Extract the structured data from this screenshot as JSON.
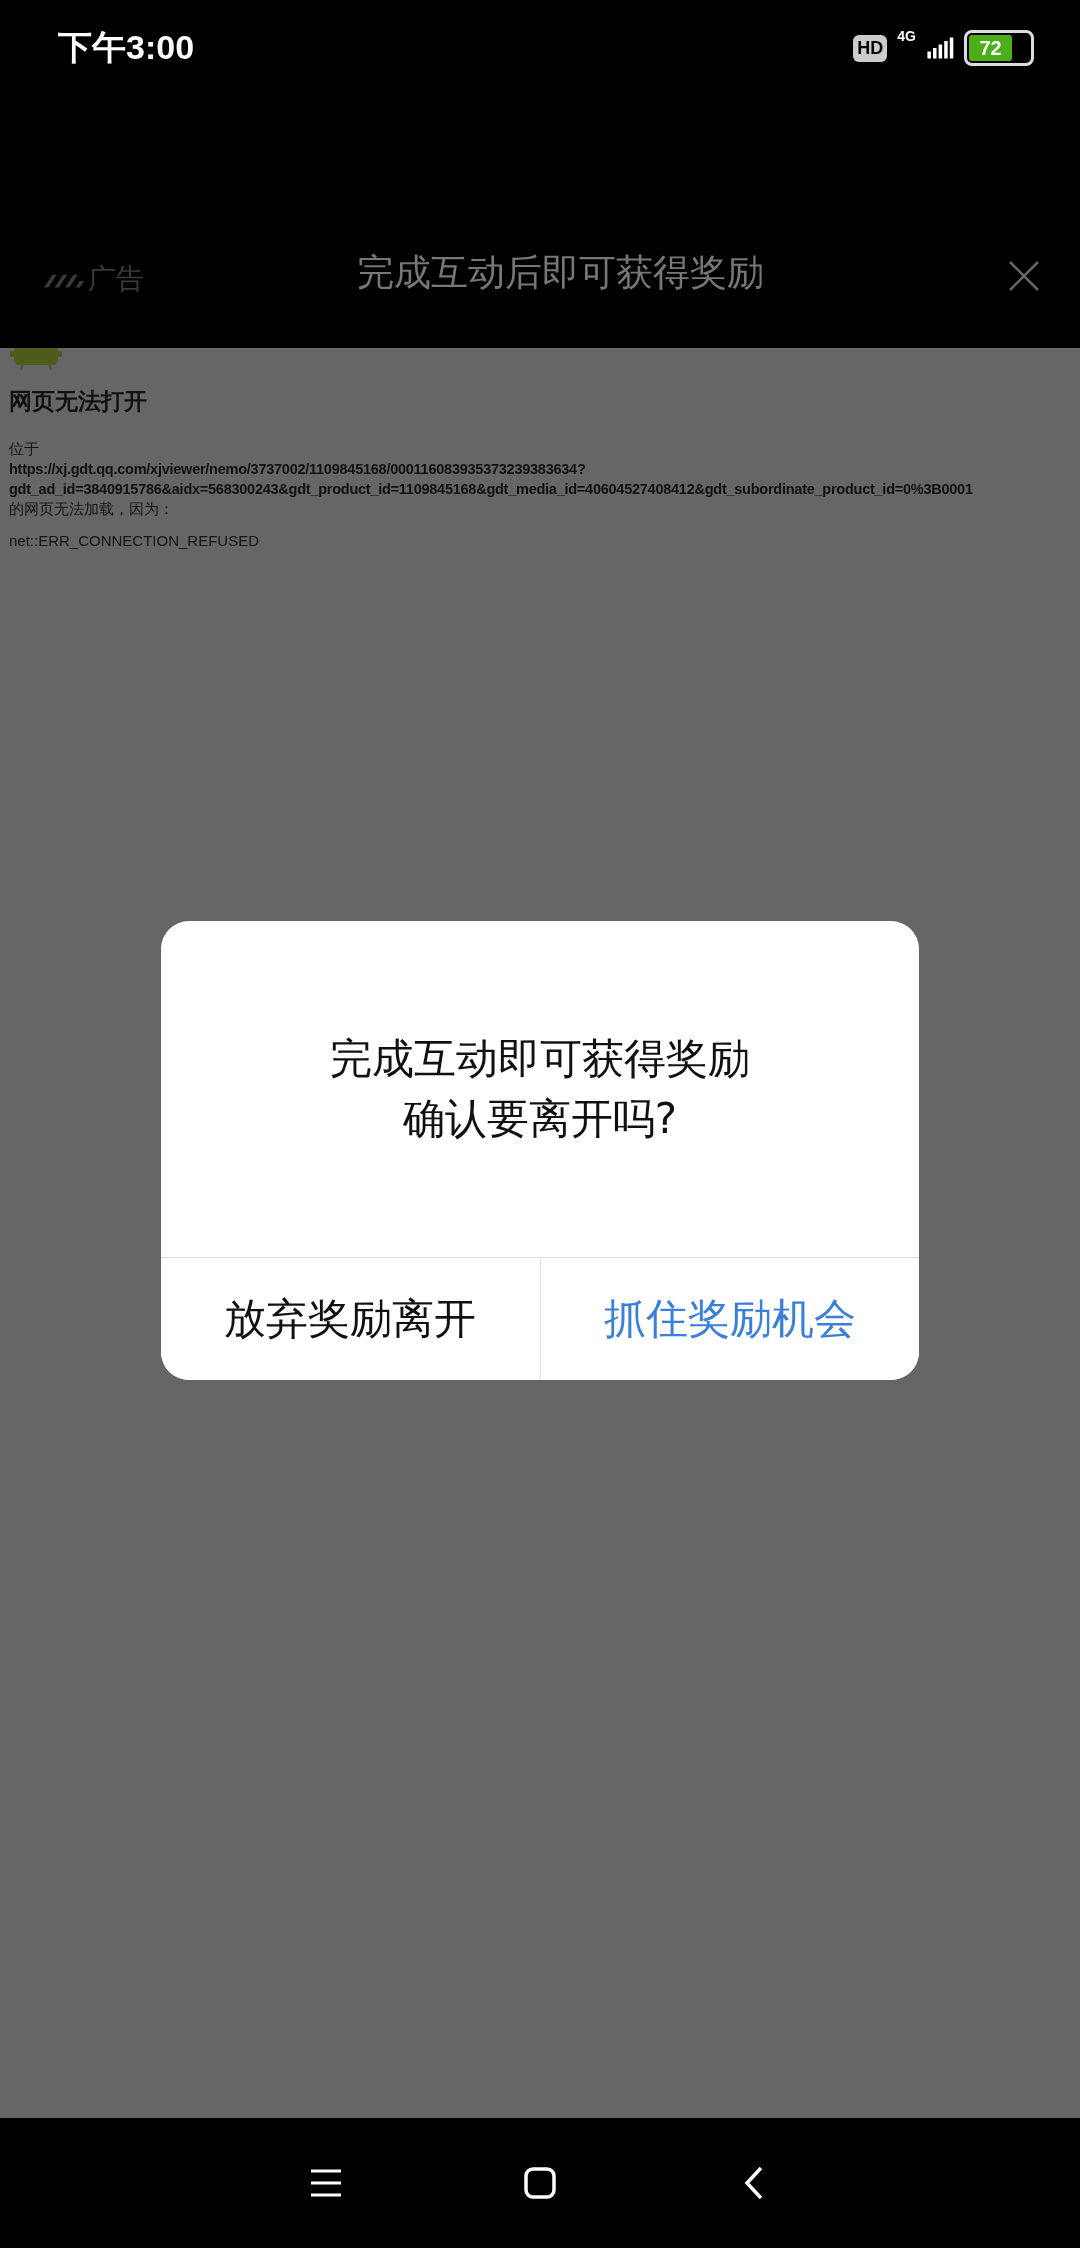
{
  "status_bar": {
    "time": "下午3:00",
    "hd_badge": "HD",
    "network": "4G",
    "battery": "72"
  },
  "ad_header": {
    "ad_label": "广告",
    "title": "完成互动后即可获得奖励"
  },
  "error_page": {
    "heading": "网页无法打开",
    "prefix": "位于",
    "url_lines": [
      "https://xj.gdt.qq.com/xjviewer/nemo/3737002/1109845168/000116083935373239383634?",
      "gdt_ad_id=3840915786&aidx=568300243&gdt_product_id=1109845168&gdt_media_id=40604527408412&gdt_subordinate_product_id=0%3B0001"
    ],
    "suffix": "的网页无法加载，因为：",
    "error_code": "net::ERR_CONNECTION_REFUSED"
  },
  "dialog": {
    "message_lines": [
      "完成互动即可获得奖励",
      "确认要离开吗?"
    ],
    "buttons": [
      {
        "label": "放弃奖励离开",
        "kind": "secondary"
      },
      {
        "label": "抓住奖励机会",
        "kind": "primary"
      }
    ]
  }
}
